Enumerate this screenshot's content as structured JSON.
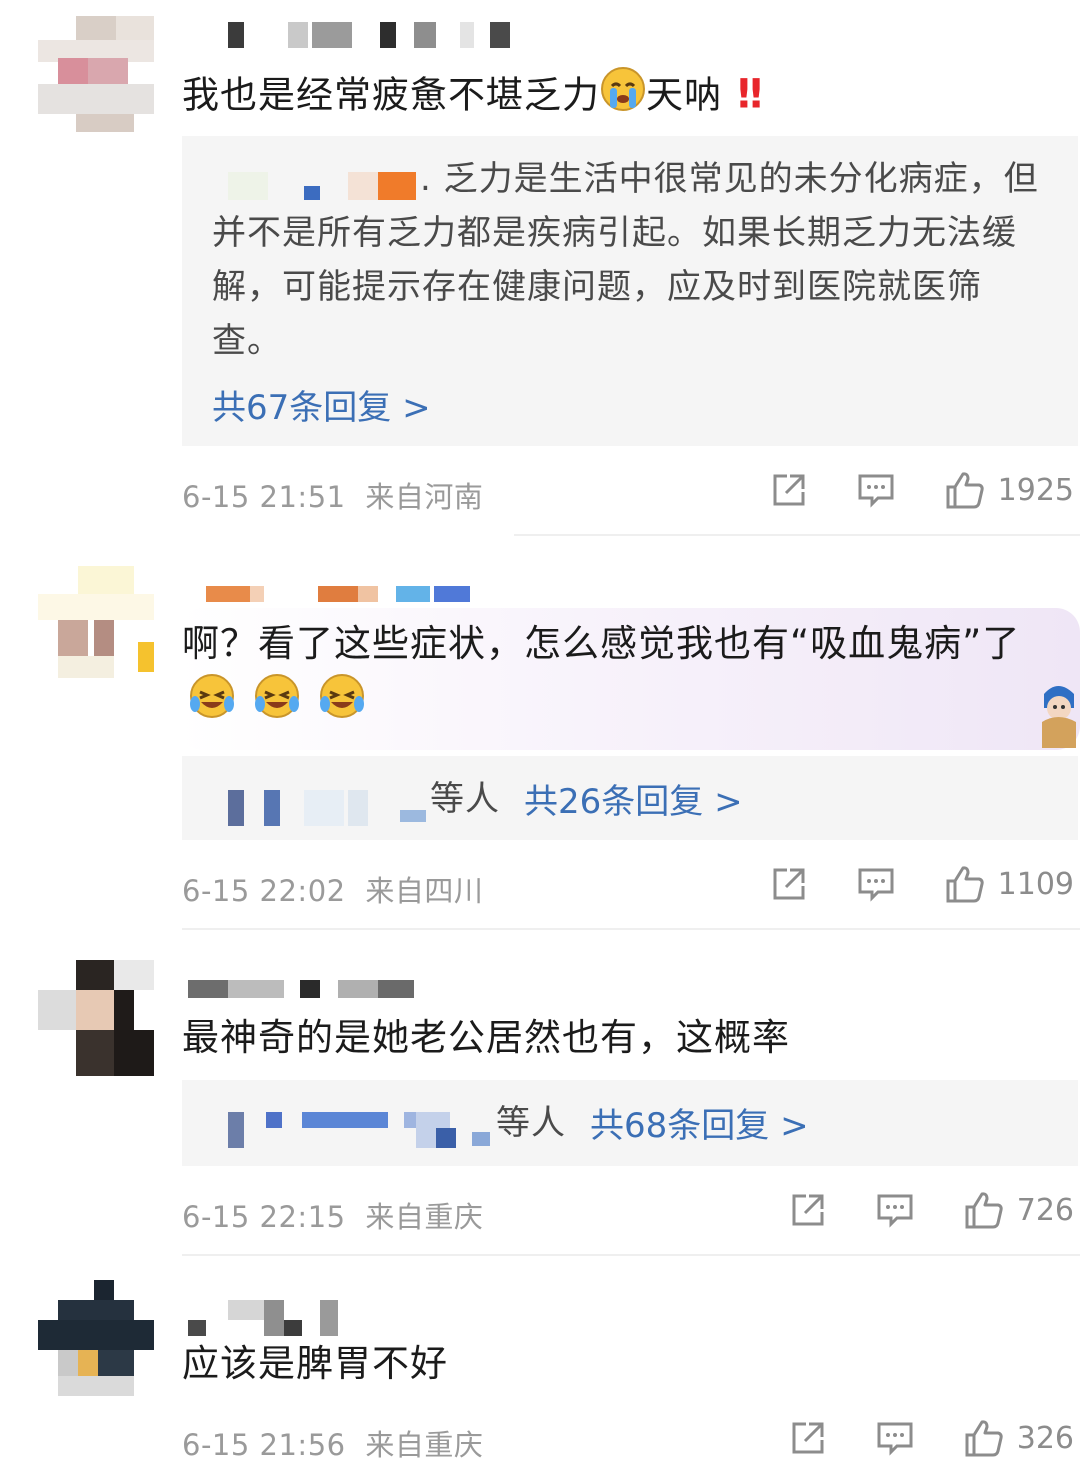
{
  "comments": [
    {
      "text": "我也是经常疲惫不堪乏力",
      "text_suffix": "天呐",
      "emoji_icons": [
        "crying-face-icon",
        "double-exclamation-icon"
      ],
      "reply": {
        "text": ". 乏力是生活中很常见的未分化病症，但并不是所有乏力都是疾病引起。如果长期乏力无法缓解，可能提示存在健康问题，应及时到医院就医筛查。",
        "link": "共67条回复 >"
      },
      "time": "6-15 21:51",
      "location": "来自河南",
      "likes": "1925"
    },
    {
      "text": "啊？看了这些症状，怎么感觉我也有“吸血鬼病”了",
      "emoji_icons": [
        "laughing-tears-icon",
        "laughing-tears-icon",
        "laughing-tears-icon"
      ],
      "reply": {
        "suffix": "等人",
        "link": "共26条回复 >"
      },
      "time": "6-15 22:02",
      "location": "来自四川",
      "likes": "1109"
    },
    {
      "text": "最神奇的是她老公居然也有，这概率",
      "reply": {
        "suffix": "等人",
        "link": "共68条回复 >"
      },
      "time": "6-15 22:15",
      "location": "来自重庆",
      "likes": "726"
    },
    {
      "text": "应该是脾胃不好",
      "time": "6-15 21:56",
      "location": "来自重庆",
      "likes": "326"
    }
  ],
  "icons": {
    "share": "share-icon",
    "comment": "comment-icon",
    "like": "thumbs-up-icon"
  },
  "colors": {
    "link": "#3b6fb5",
    "meta": "#9a9a9a",
    "reply_bg": "#f5f5f5"
  }
}
